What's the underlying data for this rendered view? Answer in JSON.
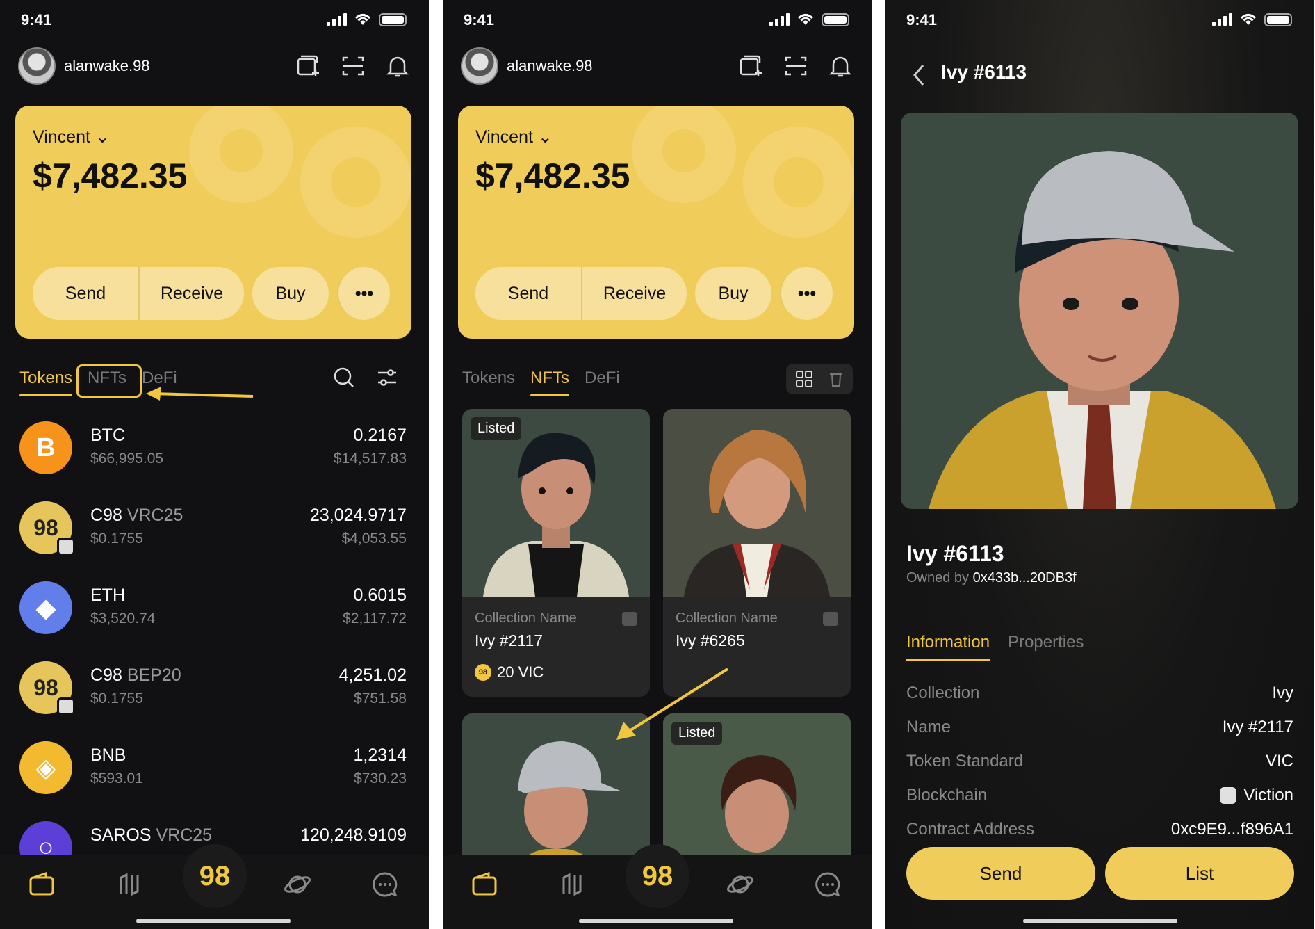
{
  "status": {
    "time": "9:41"
  },
  "user": {
    "name": "alanwake.98"
  },
  "wallet": {
    "account": "Vincent",
    "balance": "$7,482.35"
  },
  "card_actions": {
    "send": "Send",
    "receive": "Receive",
    "buy": "Buy",
    "more": "•••"
  },
  "tabs": {
    "tokens": "Tokens",
    "nfts": "NFTs",
    "defi": "DeFi"
  },
  "tokens": [
    {
      "symbol": "BTC",
      "standard": "",
      "price": "$66,995.05",
      "amount": "0.2167",
      "value": "$14,517.83",
      "color": "#f7931a",
      "glyph": "B"
    },
    {
      "symbol": "C98",
      "standard": " VRC25",
      "price": "$0.1755",
      "amount": "23,024.9717",
      "value": "$4,053.55",
      "color": "#e6c65a",
      "glyph": "98"
    },
    {
      "symbol": "ETH",
      "standard": "",
      "price": "$3,520.74",
      "amount": "0.6015",
      "value": "$2,117.72",
      "color": "#627eea",
      "glyph": "◆"
    },
    {
      "symbol": "C98",
      "standard": " BEP20",
      "price": "$0.1755",
      "amount": "4,251.02",
      "value": "$751.58",
      "color": "#e6c65a",
      "glyph": "98"
    },
    {
      "symbol": "BNB",
      "standard": "",
      "price": "$593.01",
      "amount": "1,2314",
      "value": "$730.23",
      "color": "#f3ba2f",
      "glyph": "◈"
    },
    {
      "symbol": "SAROS",
      "standard": " VRC25",
      "price": "",
      "amount": "120,248.9109",
      "value": "",
      "color": "#5b3fd6",
      "glyph": "○"
    }
  ],
  "nfts": [
    {
      "listed": "Listed",
      "collection": "Collection Name",
      "name": "Ivy #2117",
      "price": "20 VIC"
    },
    {
      "listed": "",
      "collection": "Collection Name",
      "name": "Ivy #6265",
      "price": ""
    },
    {
      "listed": "",
      "collection": "",
      "name": "",
      "price": ""
    },
    {
      "listed": "Listed",
      "collection": "",
      "name": "",
      "price": ""
    }
  ],
  "detail": {
    "title": "Ivy #6113",
    "name": "Ivy #6113",
    "owned_label": "Owned by",
    "owner": "0x433b...20DB3f",
    "tab_info": "Information",
    "tab_props": "Properties",
    "rows": [
      {
        "k": "Collection",
        "v": "Ivy"
      },
      {
        "k": "Name",
        "v": "Ivy #2117"
      },
      {
        "k": "Token Standard",
        "v": "VIC"
      },
      {
        "k": "Blockchain",
        "v": "Viction"
      },
      {
        "k": "Contract Address",
        "v": "0xc9E9...f896A1"
      }
    ],
    "send": "Send",
    "list": "List"
  },
  "brand": {
    "mark": "98",
    "accent": "#f0c73e",
    "card": "#f0cd5a"
  },
  "nav_icons": [
    "wallet-icon",
    "swap-icon",
    "home-98-icon",
    "planet-icon",
    "chat-icon"
  ]
}
